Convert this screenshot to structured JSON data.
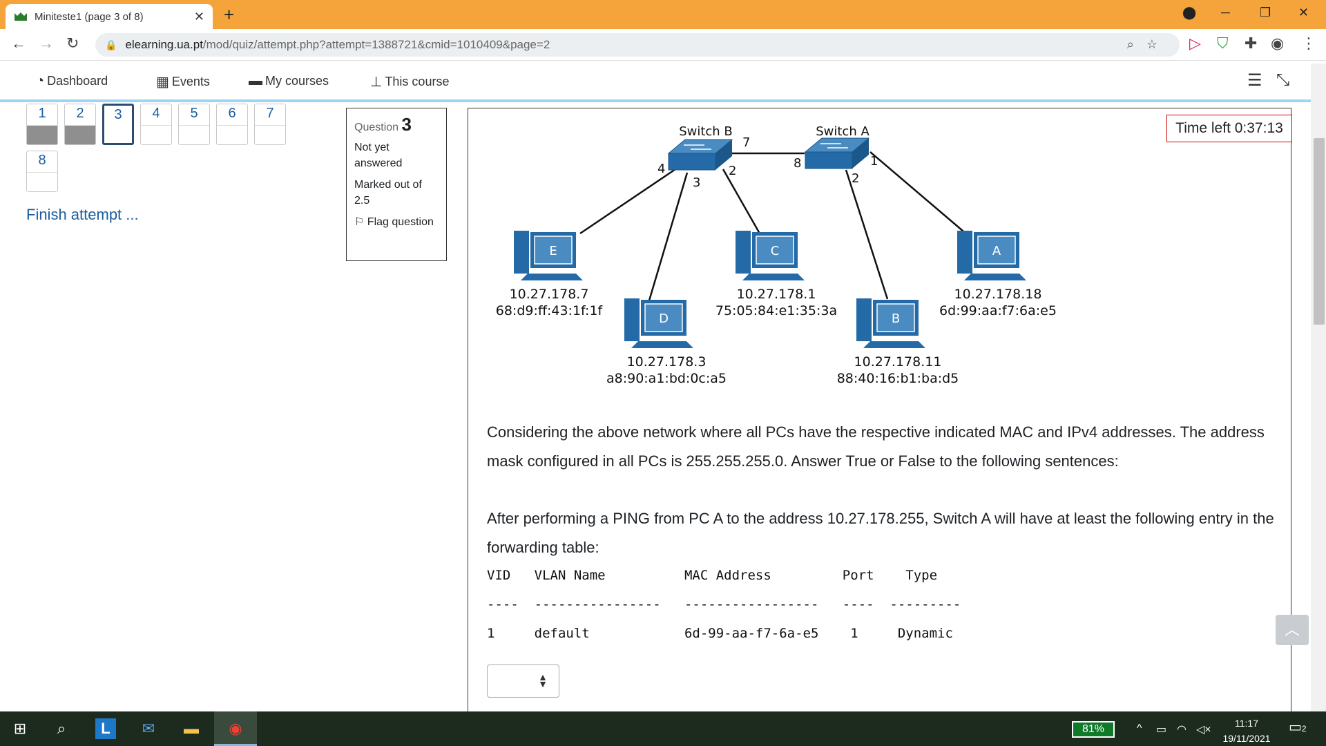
{
  "browser": {
    "tab_title": "Miniteste1 (page 3 of 8)",
    "tab_close": "✕",
    "new_tab": "+",
    "url_host": "elearning.ua.pt",
    "url_path": "/mod/quiz/attempt.php?attempt=1388721&cmid=1010409&page=2"
  },
  "moodle_nav": {
    "items": [
      {
        "label": "Dashboard",
        "icon": "dashboard-icon"
      },
      {
        "label": "Events",
        "icon": "calendar-icon"
      },
      {
        "label": "My courses",
        "icon": "briefcase-icon"
      },
      {
        "label": "This course",
        "icon": "sitemap-icon"
      }
    ]
  },
  "quiz_nav": {
    "questions": [
      {
        "num": "1",
        "state": "answered"
      },
      {
        "num": "2",
        "state": "answered"
      },
      {
        "num": "3",
        "state": "current"
      },
      {
        "num": "4",
        "state": "notyet"
      },
      {
        "num": "5",
        "state": "notyet"
      },
      {
        "num": "6",
        "state": "notyet"
      },
      {
        "num": "7",
        "state": "notyet"
      },
      {
        "num": "8",
        "state": "notyet"
      }
    ],
    "finish": "Finish attempt ..."
  },
  "question_info": {
    "label": "Question",
    "number": "3",
    "state": "Not yet answered",
    "grade": "Marked out of 2.5",
    "flag": "Flag question"
  },
  "timer": "Time left 0:37:13",
  "diagram": {
    "switch_b": {
      "label": "Switch B",
      "ports": [
        "7",
        "4",
        "3",
        "2"
      ]
    },
    "switch_a": {
      "label": "Switch A",
      "ports": [
        "8",
        "1",
        "2"
      ]
    },
    "pcs": [
      {
        "name": "E",
        "ip": "10.27.178.7",
        "mac": "68:d9:ff:43:1f:1f"
      },
      {
        "name": "D",
        "ip": "10.27.178.3",
        "mac": "a8:90:a1:bd:0c:a5"
      },
      {
        "name": "C",
        "ip": "10.27.178.1",
        "mac": "75:05:84:e1:35:3a"
      },
      {
        "name": "B",
        "ip": "10.27.178.11",
        "mac": "88:40:16:b1:ba:d5"
      },
      {
        "name": "A",
        "ip": "10.27.178.18",
        "mac": "6d:99:aa:f7:6a:e5"
      }
    ]
  },
  "question": {
    "intro": "Considering the above network where all PCs have the respective indicated MAC and IPv4 addresses. The address mask configured in all PCs is 255.255.255.0. Answer True or False to the following sentences:",
    "statement": "After performing a PING from PC A to the address 10.27.178.255, Switch A will have at least the following entry in the forwarding table:",
    "table_header": "VID   VLAN Name          MAC Address         Port    Type",
    "table_sep": "----  ----------------   -----------------   ----  ---------",
    "table_row": "1     default            6d-99-aa-f7-6a-e5    1     Dynamic"
  },
  "taskbar": {
    "battery": "81%",
    "time": "11:17",
    "date": "19/11/2021",
    "notifications": "2"
  }
}
